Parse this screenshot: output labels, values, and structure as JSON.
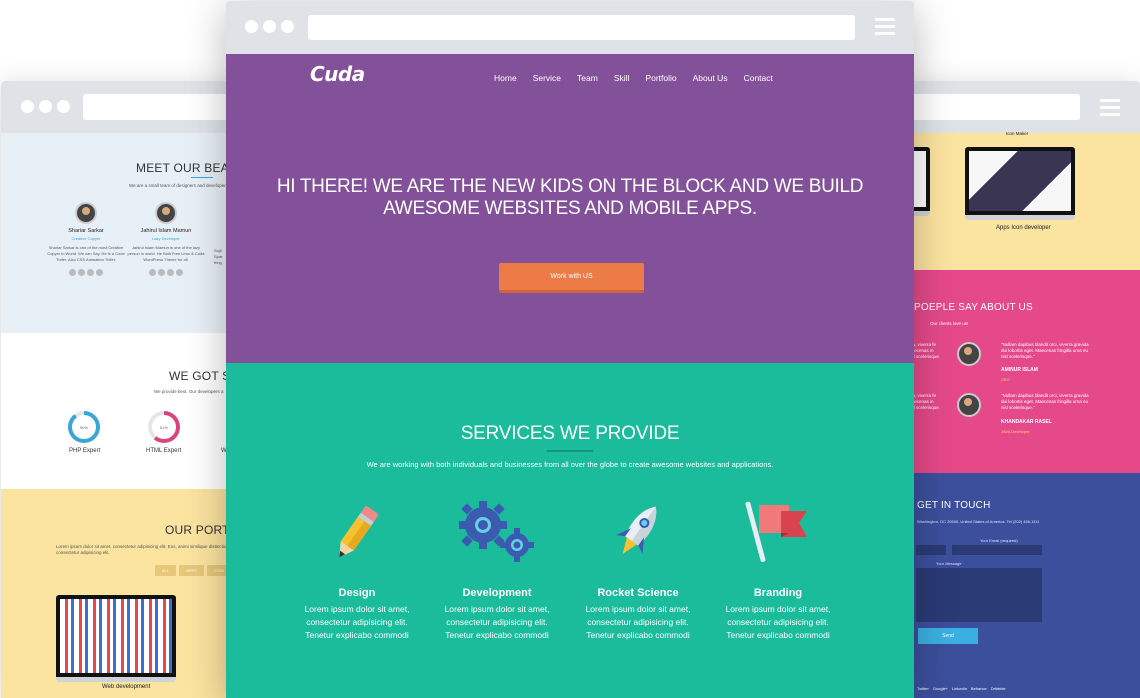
{
  "left_window": {
    "team": {
      "heading": "MEET OUR BEAUTI",
      "subtitle": "We are a small team of designers and developers, a",
      "members": [
        {
          "name": "Shariar Sarkar",
          "role": "Creative Copyer",
          "desc": "Shariar Sarkar is one of the most Creative Copyer in World. We can Say, He is a Code Thifer. Also CSS Animation Thifer."
        },
        {
          "name": "Jahirul Islam Mamun",
          "role": "Lazy Developer",
          "desc": "Jahirul Islam Mamun is one of the lazy person in world. He Built Free Limo & Cuda WordPress Theme for all."
        }
      ],
      "partial_desc": "Sojil Spar fring"
    },
    "skills": {
      "heading": "WE GOT SKI",
      "subtitle": "We provide best. Our developers a",
      "items": [
        {
          "label": "PHP Expert",
          "value": "90%",
          "percent": 90,
          "color": "#3aa6d8"
        },
        {
          "label": "HTML Expert",
          "value": "61%",
          "percent": 61,
          "color": "#d9467e"
        }
      ],
      "partial_label": "W"
    },
    "portfolio": {
      "heading": "OUR PORTFO",
      "subtitle": "Lorem ipsum dolor sit amet, consectetur adipisicing elit. Eos, animi similique distinctio dolc consectetur adipisicing elit.",
      "filters": [
        "ALL",
        "APPS",
        "ICON"
      ],
      "caption": "Web development"
    }
  },
  "right_window": {
    "portfolio": {
      "top_caption": "Icon Maker",
      "caption": "Apps Icon developer"
    },
    "testimonials": {
      "heading": "POEPLE SAY ABOUT US",
      "subtitle": "Our clients love us!",
      "partial_quote_1": "ulla, viverra fe Maecenas in nisl scelerisque.",
      "partial_quote_2": "ulla, viverra fe Maecenas in nisl scelerisque.",
      "items": [
        {
          "quote": "\"Nullam dapibus blandit orci, viverra gravida dui lobortis eget. Maecenas fringilla urna eu nisl scelerisque.\"",
          "name": "AMINUR ISLAM",
          "role": "CEO"
        },
        {
          "quote": "\"Nullam dapibus blandit orci, viverra gravida dui lobortis eget. Maecenas fringilla urna eu nisl scelerisque.\"",
          "name": "KHANDAKAR RASEL",
          "role": "JAVA Developer"
        }
      ]
    },
    "contact": {
      "heading": "GET IN TOUCH",
      "address": "Washington, DC 20500, United States of America. Tel (202) 456-1111",
      "email_label": "Your Email (required)",
      "message_label": "Your Message",
      "send_label": "Send",
      "social_links": [
        "Twitter",
        "Google+",
        "Linkedin",
        "Behance",
        "Dribbble"
      ]
    }
  },
  "center_window": {
    "logo": "Cuda",
    "nav": [
      "Home",
      "Service",
      "Team",
      "Skill",
      "Portfolio",
      "About Us",
      "Contact"
    ],
    "hero_title_line1": "HI THERE! WE ARE THE NEW KIDS ON THE BLOCK AND WE BUILD",
    "hero_title_line2": "AWESOME WEBSITES AND MOBILE APPS.",
    "cta_label": "Work with US",
    "services_title": "SERVICES WE PROVIDE",
    "services_subtitle": "We are working with both individuals and businesses from all over the globe to create awesome websites and applications.",
    "services": [
      {
        "name": "Design",
        "icon": "pencil-icon",
        "line1": "Lorem ipsum dolor sit amet,",
        "line2": "consectetur adipisicing elit.",
        "line3": "Tenetur explicabo commodi"
      },
      {
        "name": "Development",
        "icon": "gears-icon",
        "line1": "Lorem ipsum dolor sit amet,",
        "line2": "consectetur adipisicing elit.",
        "line3": "Tenetur explicabo commodi"
      },
      {
        "name": "Rocket Science",
        "icon": "rocket-icon",
        "line1": "Lorem ipsum dolor sit amet,",
        "line2": "consectetur adipisicing elit.",
        "line3": "Tenetur explicabo commodi"
      },
      {
        "name": "Branding",
        "icon": "flag-icon",
        "line1": "Lorem ipsum dolor sit amet,",
        "line2": "consectetur adipisicing elit.",
        "line3": "Tenetur explicabo commodi"
      }
    ]
  },
  "colors": {
    "hero_purple": "#82519a",
    "services_teal": "#1abc9c",
    "cta_orange": "#ec7b47",
    "testimonial_pink": "#e5498a",
    "contact_blue": "#3b4f9c",
    "portfolio_yellow": "#fbe3a0"
  }
}
